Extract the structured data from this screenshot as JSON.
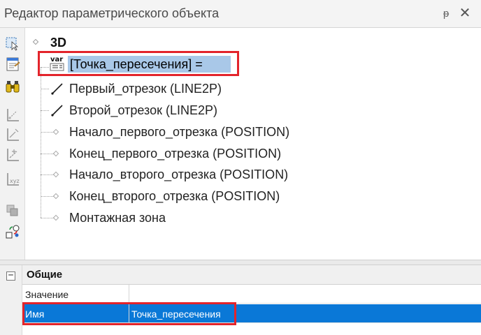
{
  "window": {
    "title": "Редактор параметрического объекта",
    "pin_glyph": "ᵽ",
    "close_glyph": "✕"
  },
  "toolbar": {
    "icons": [
      "select-icon",
      "properties-icon",
      "binoculars-icon",
      "constraint-icon",
      "constraint-edit-icon",
      "constraint-add-icon",
      "xyz-constraint-icon",
      "copy-icon",
      "geometry-swap-icon"
    ]
  },
  "tree": {
    "root": "3D",
    "selected_item": "[Точка_пересечения] =",
    "selected_icon_text": "var",
    "items": [
      {
        "label": "Первый_отрезок (LINE2P)",
        "icon": "line-icon"
      },
      {
        "label": "Второй_отрезок (LINE2P)",
        "icon": "line-icon"
      },
      {
        "label": "Начало_первого_отрезка (POSITION)",
        "icon": "point-icon"
      },
      {
        "label": "Конец_первого_отрезка (POSITION)",
        "icon": "point-icon"
      },
      {
        "label": "Начало_второго_отрезка (POSITION)",
        "icon": "point-icon"
      },
      {
        "label": "Конец_второго_отрезка (POSITION)",
        "icon": "point-icon"
      },
      {
        "label": "Монтажная зона",
        "icon": "point-icon"
      }
    ]
  },
  "properties": {
    "collapse_glyph": "−",
    "category": "Общие",
    "rows": [
      {
        "name": "Значение",
        "value": ""
      },
      {
        "name": "Имя",
        "value": "Точка_пересечения"
      }
    ]
  },
  "colors": {
    "highlight_red": "#e3242b",
    "selection_blue": "#0a78d7",
    "tree_selection": "#a9c8e8"
  }
}
